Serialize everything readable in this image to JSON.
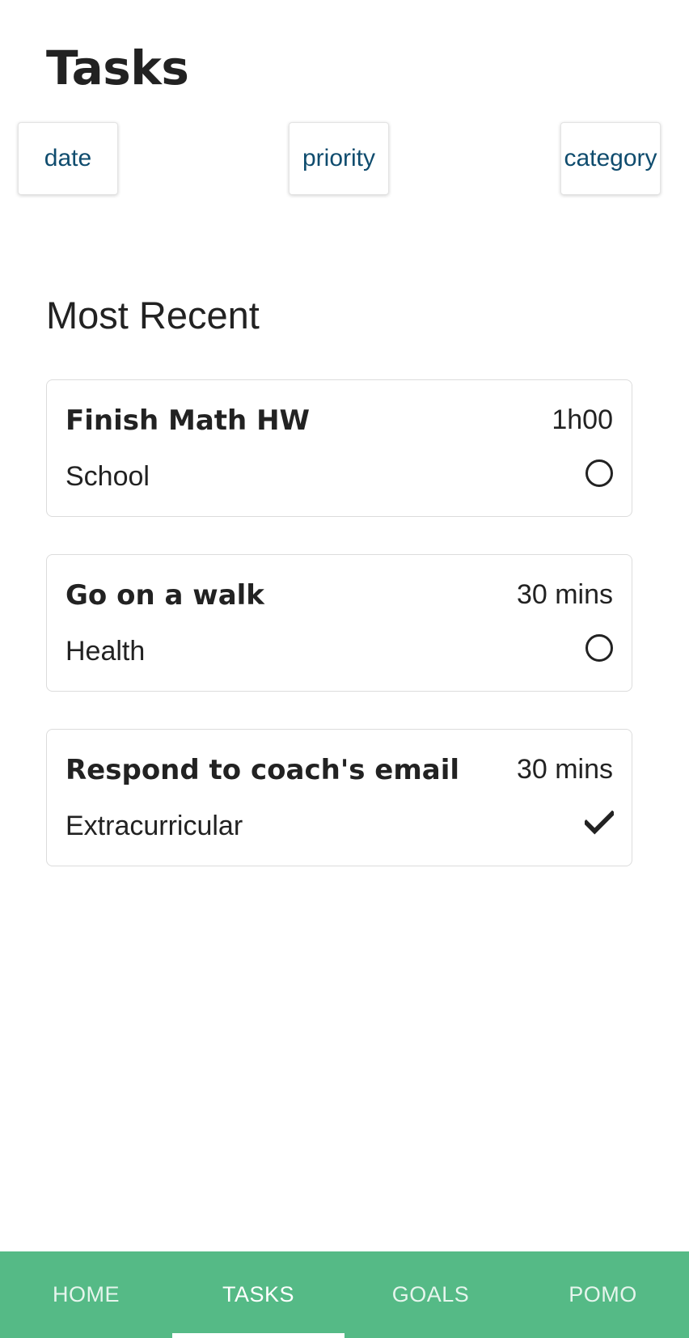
{
  "header": {
    "title": "Tasks"
  },
  "sort_options": [
    {
      "label": "date"
    },
    {
      "label": "priority"
    },
    {
      "label": "category"
    }
  ],
  "section": {
    "title": "Most Recent"
  },
  "tasks": [
    {
      "name": "Finish Math HW",
      "duration": "1h00",
      "category": "School",
      "completed": false,
      "status_icon": "circle-outline-icon"
    },
    {
      "name": "Go on a walk",
      "duration": "30 mins",
      "category": "Health",
      "completed": false,
      "status_icon": "circle-outline-icon"
    },
    {
      "name": "Respond to coach's email",
      "duration": "30 mins",
      "category": "Extracurricular",
      "completed": true,
      "status_icon": "checkmark-icon"
    }
  ],
  "bottom_nav": {
    "active": "TASKS",
    "tabs": [
      {
        "label": "HOME"
      },
      {
        "label": "TASKS"
      },
      {
        "label": "GOALS"
      },
      {
        "label": "POMO"
      }
    ]
  },
  "colors": {
    "nav_background": "#55ba86",
    "sort_text": "#0f4c6e",
    "text": "#222222"
  }
}
